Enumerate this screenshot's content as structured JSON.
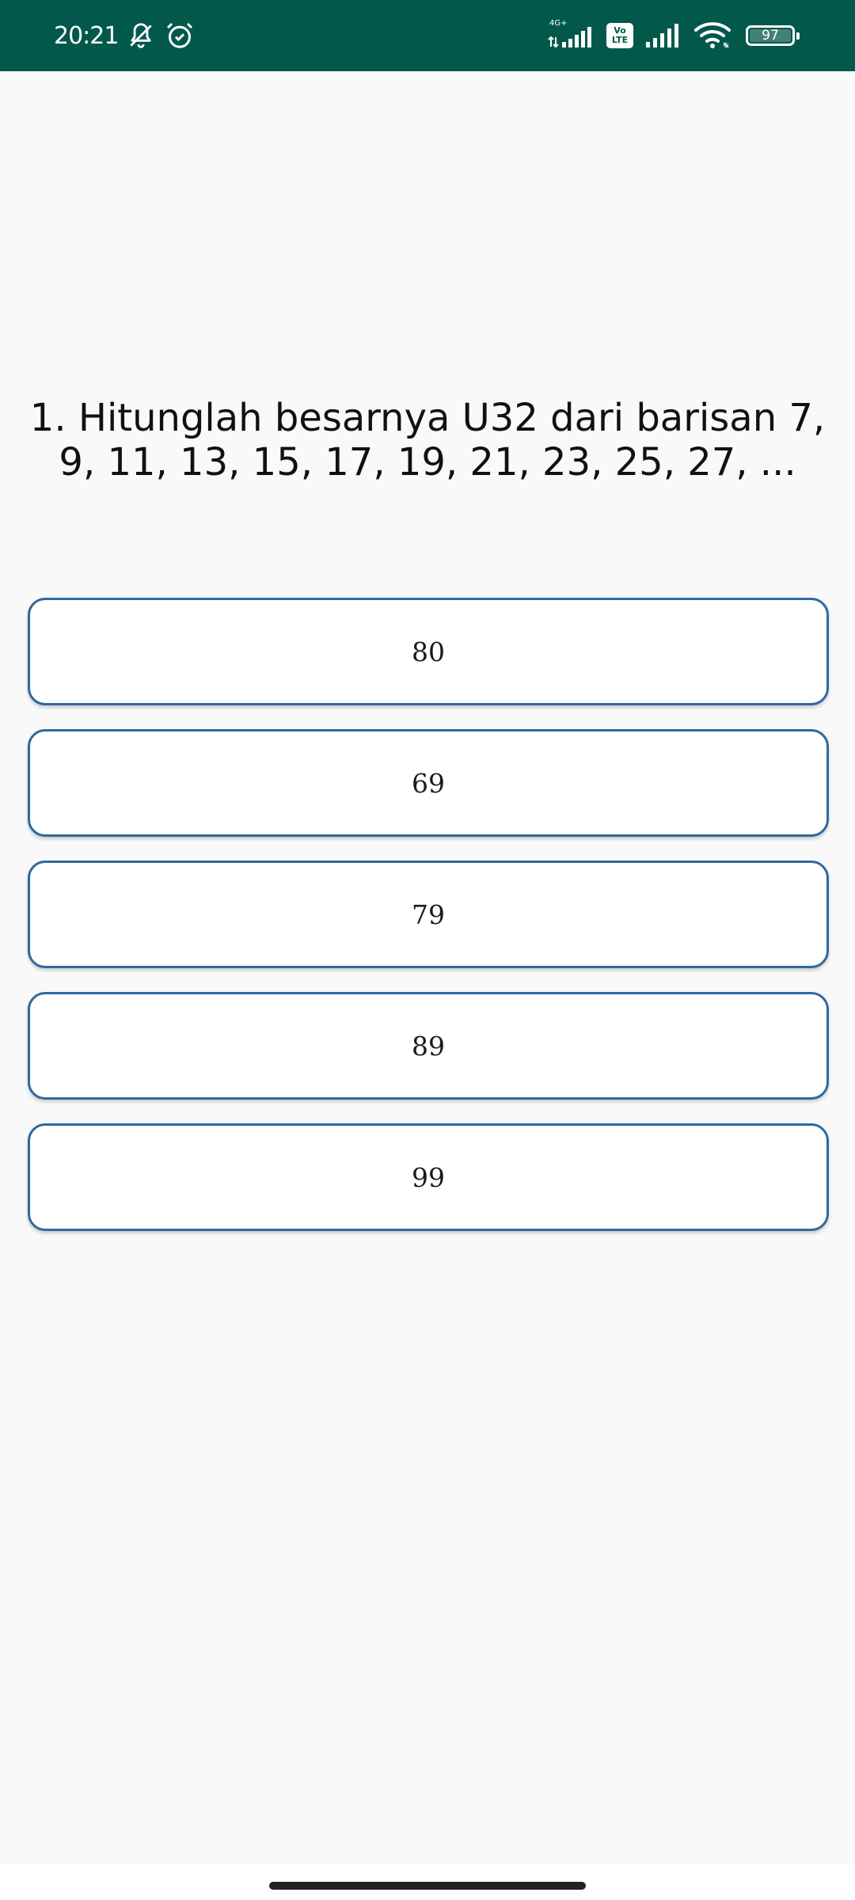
{
  "status_bar": {
    "time": "20:21",
    "network_tag": "4G+",
    "volte_line1": "Vo",
    "volte_line2": "LTE",
    "battery": "97",
    "background_color": "#02594b",
    "icons": [
      "notifications-off-icon",
      "alarm-icon",
      "signal-icon",
      "volte-icon",
      "signal-icon",
      "wifi-icon",
      "battery-icon"
    ]
  },
  "quiz": {
    "question": "1. Hitunglah besarnya U32 dari barisan 7, 9, 11, 13, 15, 17, 19, 21, 23, 25, 27, ...",
    "options": [
      {
        "label": "80"
      },
      {
        "label": "69"
      },
      {
        "label": "79"
      },
      {
        "label": "89"
      },
      {
        "label": "99"
      }
    ],
    "option_border_color": "#2f69a1"
  }
}
